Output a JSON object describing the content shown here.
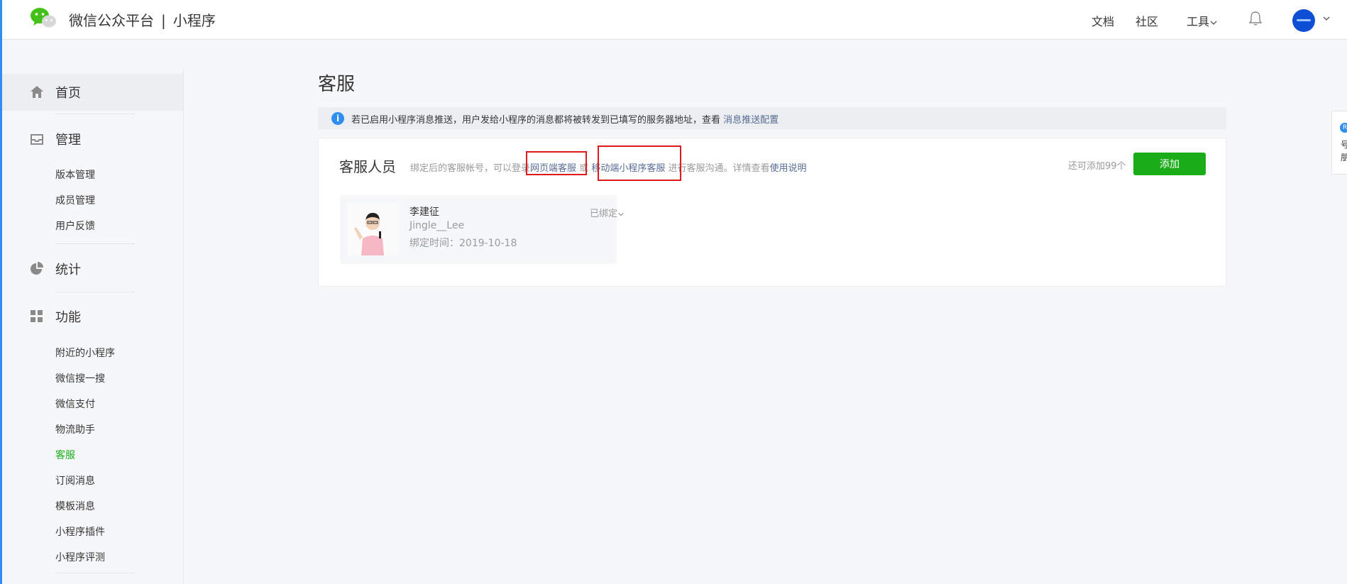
{
  "header": {
    "brand_name": "微信公众平台",
    "brand_separator": "|",
    "brand_product": "小程序",
    "nav": {
      "docs": "文档",
      "community": "社区",
      "tools": "工具"
    }
  },
  "sidebar": {
    "home": "首页",
    "manage": {
      "label": "管理",
      "items": [
        "版本管理",
        "成员管理",
        "用户反馈"
      ]
    },
    "stats": "统计",
    "features": {
      "label": "功能",
      "items": [
        "附近的小程序",
        "微信搜一搜",
        "微信支付",
        "物流助手",
        "客服",
        "订阅消息",
        "模板消息",
        "小程序插件",
        "小程序评测"
      ],
      "active_index": 4
    }
  },
  "main": {
    "title": "客服",
    "notice": {
      "text": "若已启用小程序消息推送，用户发给小程序的消息都将被转发到已填写的服务器地址，查看",
      "link": "消息推送配置"
    },
    "card": {
      "title": "客服人员",
      "desc_prefix": "绑定后的客服帐号，可以登录",
      "desc_link_web": "网页端客服",
      "desc_or": "或",
      "desc_link_mobile": "移动端小程序客服",
      "desc_mid": "进行客服沟通。详情查看",
      "desc_link_help": "使用说明",
      "remaining": "还可添加99个",
      "add_button": "添加",
      "agent": {
        "name": "李建征",
        "id": "Jingle__Lee",
        "bind_time": "绑定时间：2019-10-18",
        "status": "已绑定"
      }
    }
  },
  "floating_tab": {
    "text": "号朋"
  },
  "colors": {
    "brand_green": "#1aad19",
    "link": "#576b95",
    "info_blue": "#2f8ef0",
    "highlight_red": "#e0191d"
  }
}
